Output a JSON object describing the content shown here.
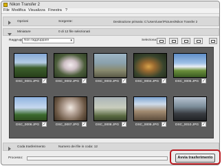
{
  "window": {
    "title": "Nikon Transfer 2"
  },
  "menu": [
    "File",
    "Modifica",
    "Visualizza",
    "Finestra",
    "?"
  ],
  "options": {
    "label": "Opzioni",
    "source_label": "Sorgente:",
    "destination_text": "Destinazione primaria:  C:\\Users\\user\\Pictures\\Nikon Transfer 2"
  },
  "thumbnails_section": {
    "label": "Miniature",
    "selected_count": "0 di 12 file selezionati"
  },
  "toolbar": {
    "group_label": "Raggruppa:",
    "group_value": "Non raggruppare",
    "select_label": "Seleziona:"
  },
  "thumbnails": [
    {
      "name": "DSC_0001.JPG",
      "checked": true
    },
    {
      "name": "DSC_0002.JPG",
      "checked": true
    },
    {
      "name": "DSC_0003.JPG",
      "checked": true
    },
    {
      "name": "DSC_0004.JPG",
      "checked": true
    },
    {
      "name": "DSC_0005.JPG",
      "checked": true
    },
    {
      "name": "DSC_0006.JPG",
      "checked": true
    },
    {
      "name": "DSC_0007.JPG",
      "checked": true
    },
    {
      "name": "DSC_0008.JPG",
      "checked": true
    },
    {
      "name": "DSC_0009.JPG",
      "checked": true
    },
    {
      "name": "DSC_0010.JPG",
      "checked": true
    }
  ],
  "queue": {
    "label": "Coda trasferimento",
    "count_text": "Numero dei file in coda: 12"
  },
  "process": {
    "label": "Processo:"
  },
  "start_button": {
    "label": "Avvia trasferimento"
  },
  "colors": {
    "highlight": "#b8191f",
    "grid_bg": "#5c5c5c"
  }
}
